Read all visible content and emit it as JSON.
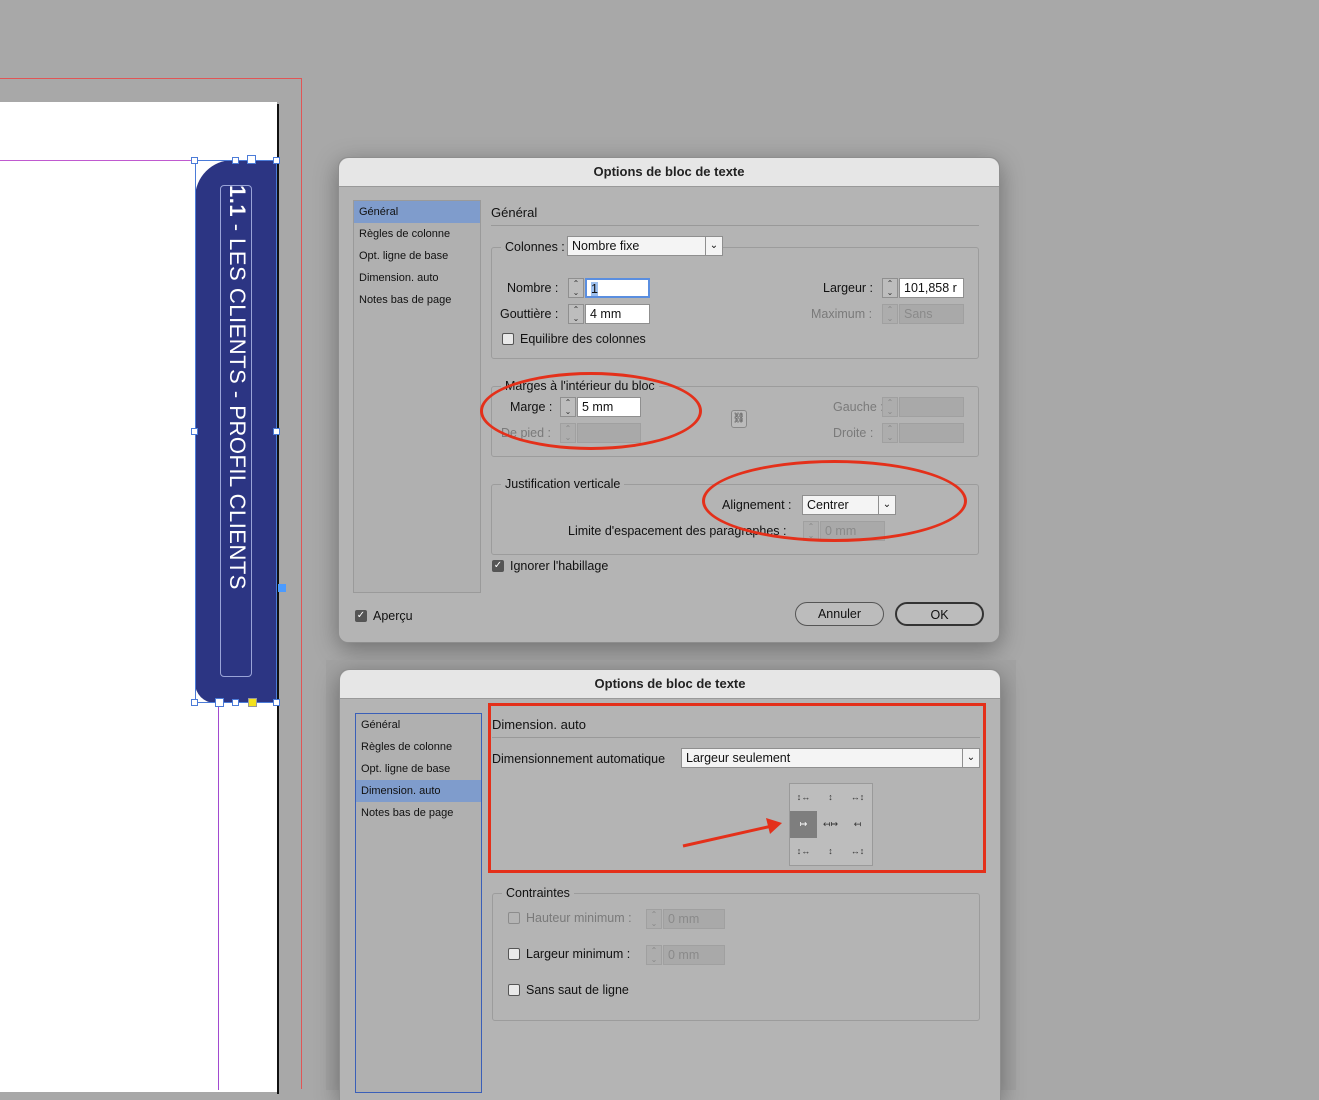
{
  "canvas": {
    "vertical_text_number": "1.1",
    "vertical_text_sep": " - ",
    "vertical_text_main": "LES CLIENTS - PROFIL CLIENTS"
  },
  "dialog1": {
    "title": "Options de bloc de texte",
    "sidebar": [
      "Général",
      "Règles de colonne",
      "Opt. ligne de base",
      "Dimension. auto",
      "Notes bas de page"
    ],
    "section_title": "Général",
    "columns": {
      "label": "Colonnes :",
      "select_value": "Nombre fixe",
      "nombre_label": "Nombre :",
      "nombre_value": "1",
      "gouttiere_label": "Gouttière :",
      "gouttiere_value": "4 mm",
      "largeur_label": "Largeur :",
      "largeur_value": "101,858 r",
      "maximum_label": "Maximum :",
      "maximum_value": "Sans",
      "balance_label": "Equilibre des colonnes"
    },
    "inset": {
      "title": "Marges à l'intérieur du bloc",
      "marge_label": "Marge :",
      "marge_value": "5 mm",
      "pied_label": "De pied :",
      "gauche_label": "Gauche :",
      "droite_label": "Droite :"
    },
    "vertical": {
      "title": "Justification verticale",
      "align_label": "Alignement :",
      "align_value": "Centrer",
      "limit_label": "Limite d'espacement des paragraphes :",
      "limit_value": "0 mm"
    },
    "ignore_wrap_label": "Ignorer l'habillage",
    "preview_label": "Aperçu",
    "cancel_label": "Annuler",
    "ok_label": "OK"
  },
  "dialog2": {
    "title": "Options de bloc de texte",
    "sidebar": [
      "Général",
      "Règles de colonne",
      "Opt. ligne de base",
      "Dimension. auto",
      "Notes bas de page"
    ],
    "section_title": "Dimension. auto",
    "autosize_label": "Dimensionnement automatique",
    "autosize_value": "Largeur seulement",
    "constraints": {
      "title": "Contraintes",
      "min_height_label": "Hauteur minimum :",
      "min_height_value": "0 mm",
      "min_width_label": "Largeur minimum :",
      "min_width_value": "0 mm",
      "no_break_label": "Sans saut de ligne"
    }
  },
  "colors": {
    "frame_fill": "#2c3583",
    "annotation_red": "#e4301a",
    "selection_blue": "#7f9ccc"
  }
}
